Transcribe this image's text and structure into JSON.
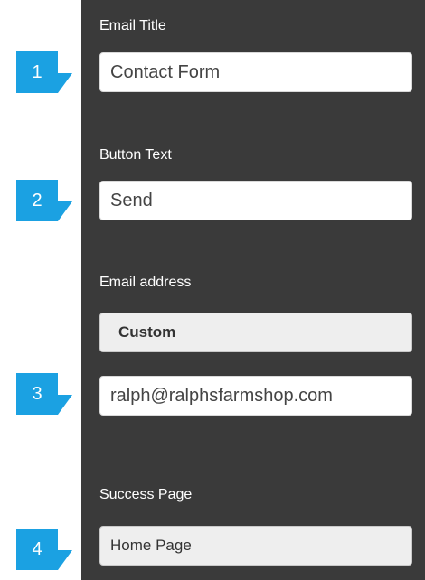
{
  "form": {
    "email_title": {
      "label": "Email Title",
      "value": "Contact Form"
    },
    "button_text": {
      "label": "Button Text",
      "value": "Send"
    },
    "email_address": {
      "label": "Email address",
      "mode": "Custom",
      "value": "ralph@ralphsfarmshop.com"
    },
    "success_page": {
      "label": "Success Page",
      "value": "Home Page"
    }
  },
  "callouts": [
    "1",
    "2",
    "3",
    "4"
  ],
  "colors": {
    "panel": "#3a3a3a",
    "callout": "#1ba1e2",
    "label_text": "#ffffff"
  }
}
